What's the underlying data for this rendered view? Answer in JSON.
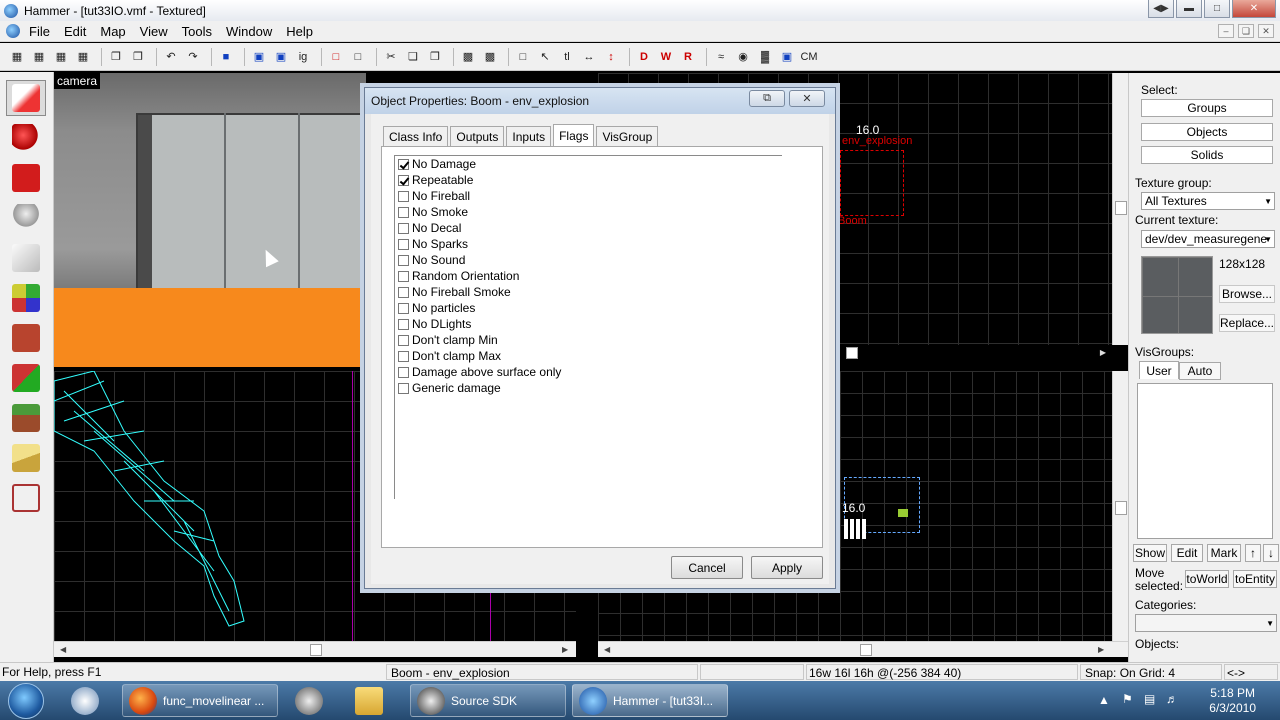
{
  "window": {
    "title": "Hammer - [tut33IO.vmf - Textured]"
  },
  "menu": [
    "File",
    "Edit",
    "Map",
    "View",
    "Tools",
    "Window",
    "Help"
  ],
  "toolbar": {
    "cordon_label": "CM"
  },
  "camera": {
    "label": "camera"
  },
  "viewports": {
    "top_right_dim": "16.0",
    "top_right_entity": "env_explosion",
    "top_right_name": "Boom",
    "bottom_right_dim": "16.0"
  },
  "dialog": {
    "title": "Object Properties: Boom - env_explosion",
    "tabs": [
      "Class Info",
      "Outputs",
      "Inputs",
      "Flags",
      "VisGroup"
    ],
    "active_tab": "Flags",
    "flags": [
      {
        "label": "No Damage",
        "checked": true
      },
      {
        "label": "Repeatable",
        "checked": true
      },
      {
        "label": "No Fireball",
        "checked": false
      },
      {
        "label": "No Smoke",
        "checked": false
      },
      {
        "label": "No Decal",
        "checked": false
      },
      {
        "label": "No Sparks",
        "checked": false
      },
      {
        "label": "No Sound",
        "checked": false
      },
      {
        "label": "Random Orientation",
        "checked": false
      },
      {
        "label": "No Fireball Smoke",
        "checked": false
      },
      {
        "label": "No particles",
        "checked": false
      },
      {
        "label": "No DLights",
        "checked": false
      },
      {
        "label": "Don't clamp Min",
        "checked": false
      },
      {
        "label": "Don't clamp Max",
        "checked": false
      },
      {
        "label": "Damage above surface only",
        "checked": false
      },
      {
        "label": "Generic damage",
        "checked": false
      }
    ],
    "cancel_label": "Cancel",
    "apply_label": "Apply"
  },
  "rightpanel": {
    "select_label": "Select:",
    "groups_label": "Groups",
    "objects_label": "Objects",
    "solids_label": "Solids",
    "texture_group_label": "Texture group:",
    "texture_group_value": "All Textures",
    "current_texture_label": "Current texture:",
    "current_texture_value": "dev/dev_measuregene",
    "texture_size": "128x128",
    "browse_label": "Browse...",
    "replace_label": "Replace...",
    "visgroups_label": "VisGroups:",
    "user_tab": "User",
    "auto_tab": "Auto",
    "show_label": "Show",
    "edit_label": "Edit",
    "mark_label": "Mark",
    "move_selected_label": "Move selected:",
    "toworld_label": "toWorld",
    "toentity_label": "toEntity",
    "categories_label": "Categories:",
    "objects_list_label": "Objects:"
  },
  "status": {
    "help": "For Help, press F1",
    "selection": "Boom - env_explosion",
    "size": "16w 16l 16h @(-256 384 40)",
    "snap": "Snap: On Grid: 4",
    "extra": "<->"
  },
  "taskbar": {
    "tasks": [
      "func_movelinear ...",
      "Source SDK",
      "Hammer - [tut33I..."
    ],
    "time": "5:18 PM",
    "date": "6/3/2010"
  }
}
